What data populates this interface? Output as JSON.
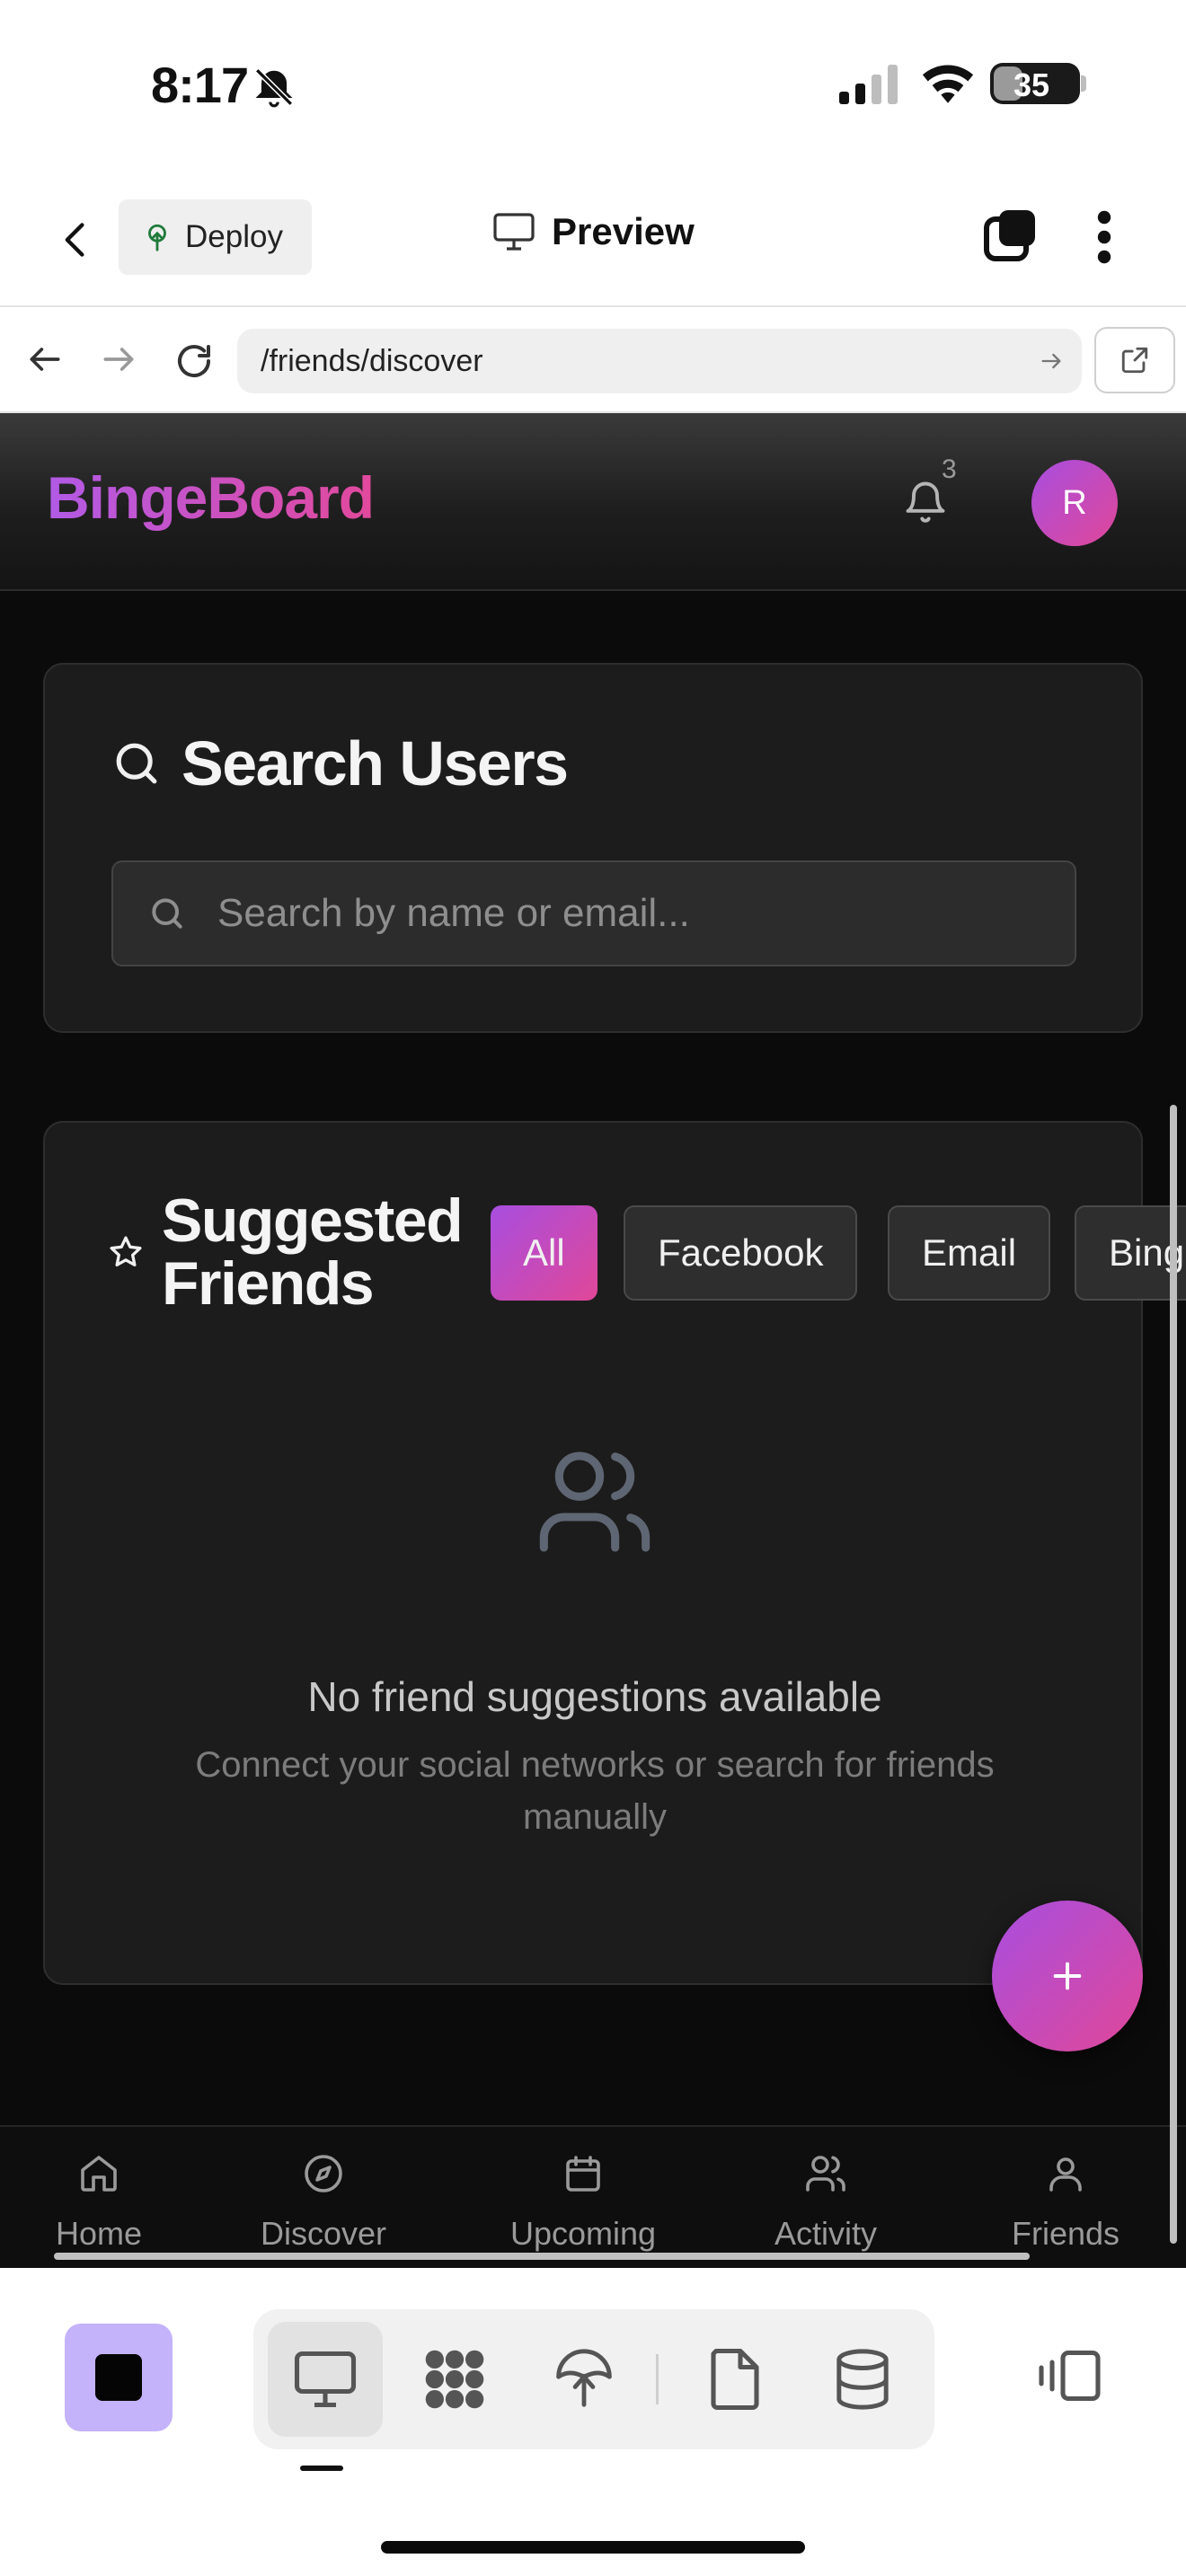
{
  "status_bar": {
    "time": "8:17",
    "battery": "35",
    "battery_level": 0.35
  },
  "app_header": {
    "deploy_label": "Deploy",
    "preview_label": "Preview"
  },
  "browser": {
    "url": "/friends/discover"
  },
  "site": {
    "brand": "BingeBoard",
    "notification_count": "3",
    "avatar_initial": "R",
    "accent_colors": [
      "#a84ee0",
      "#e04798"
    ]
  },
  "search": {
    "heading": "Search Users",
    "placeholder": "Search by name or email..."
  },
  "suggested": {
    "heading_line1": "Suggested",
    "heading_line2": "Friends",
    "filters": [
      {
        "label": "All",
        "active": true
      },
      {
        "label": "Facebook",
        "active": false
      },
      {
        "label": "Email",
        "active": false
      },
      {
        "label": "Bing",
        "active": false
      }
    ],
    "empty_title": "No friend suggestions available",
    "empty_description": "Connect your social networks or search for friends manually"
  },
  "fab": {
    "label": "+"
  },
  "bottom_nav": {
    "items": [
      {
        "label": "Home",
        "icon": "home-icon"
      },
      {
        "label": "Discover",
        "icon": "compass-icon"
      },
      {
        "label": "Upcoming",
        "icon": "calendar-icon"
      },
      {
        "label": "Activity",
        "icon": "users-icon"
      },
      {
        "label": "Friends",
        "icon": "user-icon"
      }
    ]
  },
  "toolbar": {
    "tools": [
      "monitor-icon",
      "apps-icon",
      "deploy-icon",
      "file-icon",
      "database-icon"
    ]
  }
}
